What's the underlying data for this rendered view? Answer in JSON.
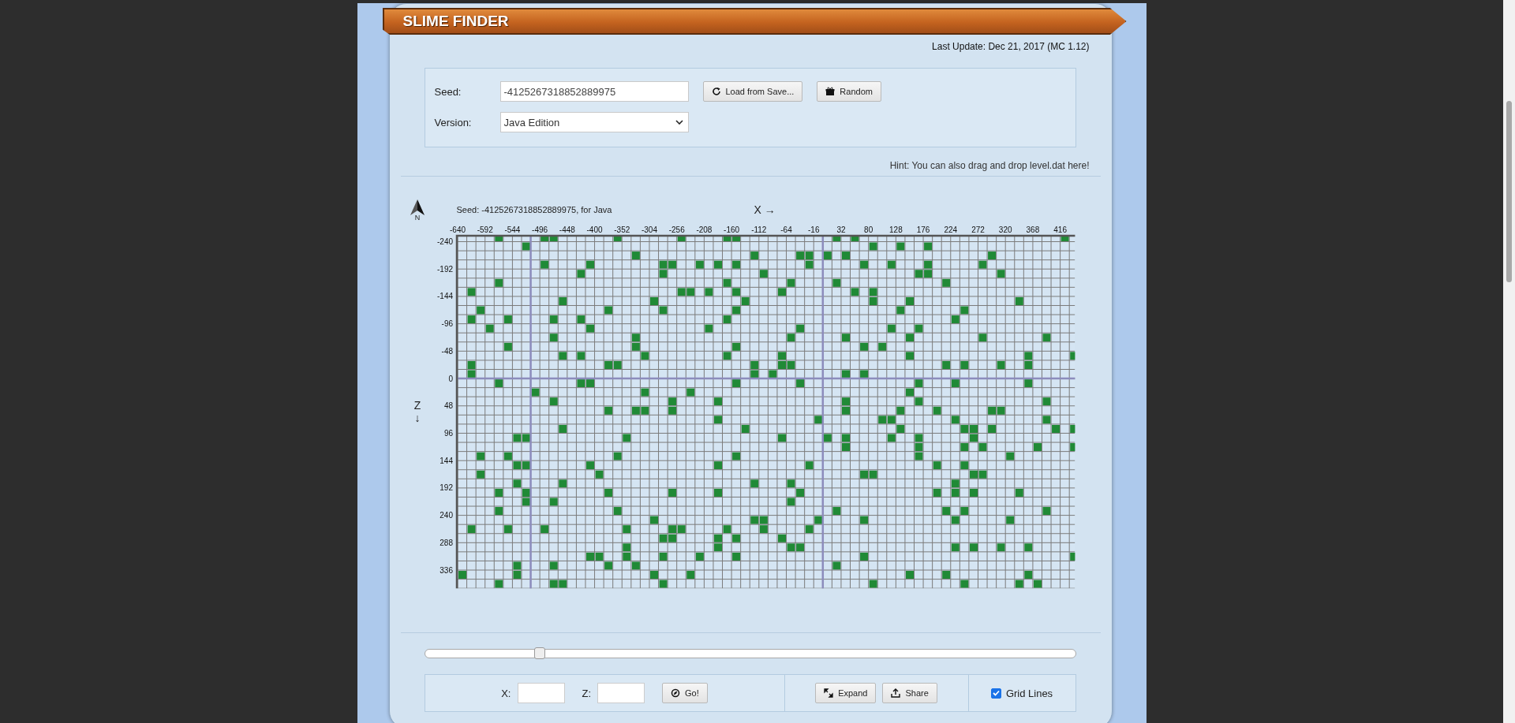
{
  "header": {
    "title": "SLIME FINDER",
    "last_update": "Last Update: Dec 21, 2017 (MC 1.12)"
  },
  "form": {
    "seed_label": "Seed:",
    "seed_value": "-4125267318852889975",
    "load_button": "Load from Save...",
    "random_button": "Random",
    "version_label": "Version:",
    "version_value": "Java Edition"
  },
  "hint": "Hint: You can also drag and drop level.dat here!",
  "map": {
    "north_label": "N",
    "chart_data": {
      "type": "scatter",
      "title": "Seed: -4125267318852889975, for Java",
      "xlabel": "X →",
      "ylabel": "Z ↓",
      "xlim": [
        -640,
        442
      ],
      "ylim": [
        368,
        -249
      ],
      "grid": true,
      "ref_lines": [
        {
          "axis": "x",
          "value": -512
        },
        {
          "axis": "x",
          "value": 0
        },
        {
          "axis": "y",
          "value": 0
        }
      ],
      "xticks": [
        -640,
        -592,
        -544,
        -496,
        -448,
        -400,
        -352,
        -304,
        -256,
        -208,
        -160,
        -112,
        -64,
        -16,
        32,
        80,
        128,
        176,
        224,
        272,
        320,
        368,
        416
      ],
      "yticks": [
        -240,
        -192,
        -144,
        -96,
        -48,
        0,
        48,
        96,
        144,
        192,
        240,
        288,
        336
      ],
      "x": [
        -568,
        -488,
        -472,
        -360,
        -248,
        -168,
        -152,
        24,
        56,
        424,
        -520,
        88,
        136,
        184,
        -328,
        -120,
        -40,
        -24,
        8,
        40,
        296,
        -488,
        -408,
        -280,
        -264,
        -216,
        -184,
        -152,
        -24,
        72,
        120,
        184,
        280,
        -424,
        -280,
        -104,
        168,
        184,
        312,
        -568,
        -168,
        -56,
        24,
        216,
        -616,
        -248,
        -232,
        -200,
        -152,
        -72,
        56,
        88,
        -456,
        -296,
        -136,
        88,
        152,
        344,
        -600,
        -376,
        -280,
        -152,
        136,
        248,
        -616,
        -552,
        -472,
        -424,
        -168,
        232,
        -584,
        -408,
        -200,
        -40,
        120,
        168,
        -472,
        -328,
        -56,
        40,
        152,
        280,
        392,
        -552,
        -328,
        -152,
        72,
        104,
        -456,
        -424,
        -312,
        -168,
        -72,
        152,
        360,
        440,
        -616,
        -376,
        -360,
        -120,
        -72,
        -56,
        216,
        248,
        312,
        360,
        -616,
        -120,
        -88,
        40,
        72,
        -568,
        -424,
        -408,
        -152,
        -40,
        168,
        232,
        360,
        -504,
        -312,
        -232,
        152,
        -472,
        -264,
        -184,
        40,
        168,
        392,
        -376,
        -328,
        -312,
        -264,
        40,
        136,
        200,
        296,
        312,
        -184,
        -8,
        104,
        120,
        232,
        392,
        -456,
        -136,
        136,
        248,
        264,
        296,
        408,
        440,
        -536,
        -520,
        -344,
        -72,
        8,
        40,
        120,
        168,
        264,
        40,
        168,
        248,
        280,
        376,
        440,
        -600,
        -552,
        -360,
        -152,
        168,
        328,
        -536,
        -520,
        -408,
        -184,
        -24,
        200,
        248,
        -600,
        -392,
        72,
        88,
        264,
        280,
        -536,
        -456,
        -120,
        -56,
        232,
        -568,
        -520,
        -376,
        -264,
        -184,
        -40,
        200,
        232,
        264,
        344,
        -520,
        -472,
        -56,
        -568,
        -360,
        24,
        216,
        248,
        392,
        -296,
        -120,
        -104,
        -8,
        72,
        232,
        328,
        -616,
        -552,
        -488,
        -344,
        -264,
        -248,
        -168,
        -104,
        -24,
        -280,
        -264,
        -184,
        -152,
        -72,
        -344,
        -184,
        -56,
        -40,
        232,
        264,
        312,
        360,
        -408,
        -392,
        -344,
        -280,
        -216,
        -152,
        72,
        440,
        -536,
        -472,
        -376,
        -328,
        24,
        -632,
        -536,
        -296,
        -232,
        152,
        216,
        360,
        -568,
        -472,
        -456,
        -280,
        88,
        248,
        344,
        376
      ],
      "series": [
        {
          "color": "#208a36",
          "values": [
            -248,
            -248,
            -248,
            -248,
            -248,
            -248,
            -248,
            -248,
            -248,
            -248,
            -232,
            -232,
            -232,
            -232,
            -216,
            -216,
            -216,
            -216,
            -216,
            -216,
            -216,
            -200,
            -200,
            -200,
            -200,
            -200,
            -200,
            -200,
            -200,
            -200,
            -200,
            -200,
            -200,
            -184,
            -184,
            -184,
            -184,
            -184,
            -184,
            -168,
            -168,
            -168,
            -168,
            -168,
            -152,
            -152,
            -152,
            -152,
            -152,
            -152,
            -152,
            -152,
            -136,
            -136,
            -136,
            -136,
            -136,
            -136,
            -120,
            -120,
            -120,
            -120,
            -120,
            -120,
            -104,
            -104,
            -104,
            -104,
            -104,
            -104,
            -88,
            -88,
            -88,
            -88,
            -88,
            -88,
            -72,
            -72,
            -72,
            -72,
            -72,
            -72,
            -72,
            -56,
            -56,
            -56,
            -56,
            -56,
            -40,
            -40,
            -40,
            -40,
            -40,
            -40,
            -40,
            -40,
            -24,
            -24,
            -24,
            -24,
            -24,
            -24,
            -24,
            -24,
            -24,
            -24,
            -8,
            -8,
            -8,
            -8,
            -8,
            8,
            8,
            8,
            8,
            8,
            8,
            8,
            8,
            24,
            24,
            24,
            24,
            40,
            40,
            40,
            40,
            40,
            40,
            56,
            56,
            56,
            56,
            56,
            56,
            56,
            56,
            56,
            72,
            72,
            72,
            72,
            72,
            72,
            88,
            88,
            88,
            88,
            88,
            88,
            88,
            88,
            104,
            104,
            104,
            104,
            104,
            104,
            104,
            104,
            104,
            120,
            120,
            120,
            120,
            120,
            120,
            136,
            136,
            136,
            136,
            136,
            136,
            152,
            152,
            152,
            152,
            152,
            152,
            152,
            168,
            168,
            168,
            168,
            168,
            168,
            184,
            184,
            184,
            184,
            184,
            200,
            200,
            200,
            200,
            200,
            200,
            200,
            200,
            200,
            200,
            216,
            216,
            216,
            232,
            232,
            232,
            232,
            232,
            232,
            248,
            248,
            248,
            248,
            248,
            248,
            248,
            264,
            264,
            264,
            264,
            264,
            264,
            264,
            264,
            264,
            280,
            280,
            280,
            280,
            280,
            296,
            296,
            296,
            296,
            296,
            296,
            296,
            296,
            312,
            312,
            312,
            312,
            312,
            312,
            312,
            312,
            328,
            328,
            328,
            328,
            328,
            344,
            344,
            344,
            344,
            344,
            344,
            344,
            360,
            360,
            360,
            360,
            360,
            360,
            360,
            360
          ]
        }
      ]
    }
  },
  "slider": {
    "level": 0.177
  },
  "toolbar": {
    "x_label": "X:",
    "z_label": "Z:",
    "go_button": "Go!",
    "expand_button": "Expand",
    "share_button": "Share",
    "grid_lines": {
      "label": "Grid Lines",
      "checked": true
    }
  }
}
